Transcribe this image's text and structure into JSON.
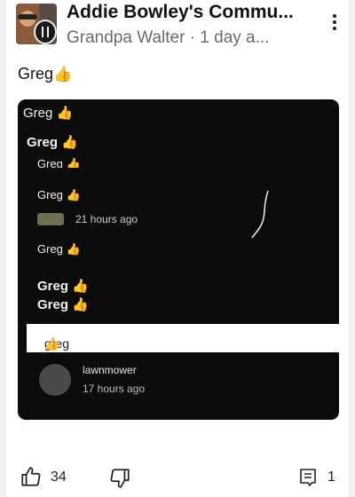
{
  "header": {
    "author": "Addie Bowley's Commu...",
    "meta": "Grandpa Walter · 1 day a..."
  },
  "post": {
    "text": "Greg",
    "emoji": "👍"
  },
  "image": {
    "lines": [
      "Greg",
      "Greg",
      "Greg",
      "Greg",
      "Greg",
      "Greg",
      "Greg"
    ],
    "emoji": "👍",
    "timestamp_1": "21 hours ago",
    "highlight_text": "greg",
    "commenter": "lawnmower",
    "timestamp_2": "17 hours ago"
  },
  "actions": {
    "like_count": "34",
    "comment_count": "1"
  }
}
